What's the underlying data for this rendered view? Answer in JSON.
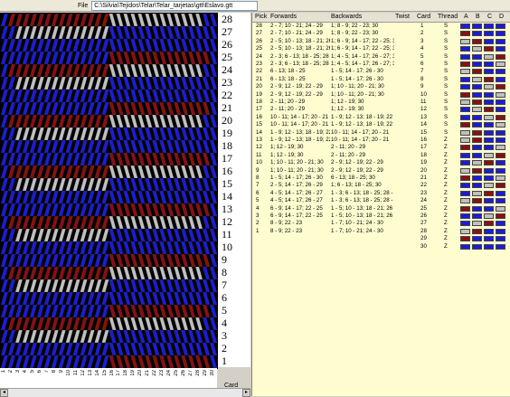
{
  "toolbar": {
    "file_label": "File",
    "path": "C:\\Silvia\\Tejidos\\Telar\\Telar_tarjetas\\gtt\\Eslavo.gtt"
  },
  "colors": {
    "blue": "#1c1cd8",
    "red": "#8a1010",
    "grey": "#c0c0c0",
    "white": "#ffffff"
  },
  "pattern_rows": [
    "28",
    "27",
    "26",
    "25",
    "24",
    "23",
    "22",
    "21",
    "20",
    "19",
    "18",
    "17",
    "16",
    "15",
    "14",
    "13",
    "12",
    "11",
    "10",
    "9",
    "8",
    "7",
    "6",
    "5",
    "4",
    "3",
    "2",
    "1"
  ],
  "card_label": "Card",
  "card_numbers": [
    "1",
    "2",
    "3",
    "4",
    "5",
    "6",
    "7",
    "8",
    "9",
    "10",
    "11",
    "12",
    "13",
    "14",
    "15",
    "16",
    "17",
    "18",
    "19",
    "20",
    "21",
    "22",
    "23",
    "24",
    "25",
    "26",
    "27",
    "28",
    "29",
    "30"
  ],
  "picks_table": {
    "headers": {
      "pick": "Pick",
      "forwards": "Forwards",
      "backwards": "Backwards",
      "twist": "Twist",
      "card": "Card",
      "thread": "Thread",
      "a": "A",
      "b": "B",
      "c": "C",
      "d": "D"
    },
    "picks": [
      {
        "pick": "28",
        "forwards": "2 - 7; 10 - 21; 24 - 29",
        "backwards": "1; 8 - 9; 22 - 23; 30"
      },
      {
        "pick": "27",
        "forwards": "2 - 7; 10 - 21; 24 - 29",
        "backwards": "1; 8 - 9; 22 - 23; 30"
      },
      {
        "pick": "26",
        "forwards": "2 - 5; 10 - 13; 18 - 21; 26 - 29",
        "backwards": "1; 6 - 9; 14 - 17; 22 - 25; 30"
      },
      {
        "pick": "25",
        "forwards": "2 - 5; 10 - 13; 18 - 21; 26 - 29",
        "backwards": "1; 6 - 9; 14 - 17; 22 - 25; 30"
      },
      {
        "pick": "24",
        "forwards": "2 - 3; 6 - 13; 18 - 25; 28 - 29",
        "backwards": "1; 4 - 5; 14 - 17; 26 - 27; 30"
      },
      {
        "pick": "23",
        "forwards": "2 - 3; 6 - 13; 18 - 25; 28 - 29",
        "backwards": "1; 4 - 5; 14 - 17; 26 - 27; 30"
      },
      {
        "pick": "22",
        "forwards": "6 - 13; 18 - 25",
        "backwards": "1 - 5; 14 - 17; 26 - 30"
      },
      {
        "pick": "21",
        "forwards": "6 - 13; 18 - 25",
        "backwards": "1 - 5; 14 - 17; 26 - 30"
      },
      {
        "pick": "20",
        "forwards": "2 - 9; 12 - 19; 22 - 29",
        "backwards": "1; 10 - 11; 20 - 21; 30"
      },
      {
        "pick": "19",
        "forwards": "2 - 9; 12 - 19; 22 - 29",
        "backwards": "1; 10 - 11; 20 - 21; 30"
      },
      {
        "pick": "18",
        "forwards": "2 - 11; 20 - 29",
        "backwards": "1; 12 - 19; 30"
      },
      {
        "pick": "17",
        "forwards": "2 - 11; 20 - 29",
        "backwards": "1; 12 - 19; 30"
      },
      {
        "pick": "16",
        "forwards": "10 - 11; 14 - 17; 20 - 21",
        "backwards": "1 - 9; 12 - 13; 18 - 19; 22 - 30"
      },
      {
        "pick": "15",
        "forwards": "10 - 11; 14 - 17; 20 - 21",
        "backwards": "1 - 9; 12 - 13; 18 - 19; 22 - 30"
      },
      {
        "pick": "14",
        "forwards": "1 - 9; 12 - 13; 18 - 19; 22 - 30",
        "backwards": "10 - 11; 14 - 17; 20 - 21"
      },
      {
        "pick": "13",
        "forwards": "1 - 9; 12 - 13; 18 - 19; 22 - 30",
        "backwards": "10 - 11; 14 - 17; 20 - 21"
      },
      {
        "pick": "12",
        "forwards": "1; 12 - 19; 30",
        "backwards": "2 - 11; 20 - 29"
      },
      {
        "pick": "11",
        "forwards": "1; 12 - 19; 30",
        "backwards": "2 - 11; 20 - 29"
      },
      {
        "pick": "10",
        "forwards": "1; 10 - 11; 20 - 21; 30",
        "backwards": "2 - 9; 12 - 19; 22 - 29"
      },
      {
        "pick": "9",
        "forwards": "1; 10 - 11; 20 - 21; 30",
        "backwards": "2 - 9; 12 - 19; 22 - 29"
      },
      {
        "pick": "8",
        "forwards": "1 - 5; 14 - 17; 26 - 30",
        "backwards": "6 - 13; 18 - 25; 30"
      },
      {
        "pick": "7",
        "forwards": "2 - 5; 14 - 17; 26 - 29",
        "backwards": "1; 6 - 13; 18 - 25; 30"
      },
      {
        "pick": "6",
        "forwards": "4 - 5; 14 - 17; 26 - 27",
        "backwards": "1 - 3; 6 - 13; 18 - 25; 28 - 30"
      },
      {
        "pick": "5",
        "forwards": "4 - 5; 14 - 17; 26 - 27",
        "backwards": "1 - 3; 6 - 13; 18 - 25; 28 - 30"
      },
      {
        "pick": "4",
        "forwards": "6 - 9; 14 - 17; 22 - 25",
        "backwards": "1 - 5; 10 - 13; 18 - 21; 26 - 30"
      },
      {
        "pick": "3",
        "forwards": "6 - 9; 14 - 17; 22 - 25",
        "backwards": "1 - 5; 10 - 13; 18 - 21; 26 - 30"
      },
      {
        "pick": "2",
        "forwards": "8 - 9; 22 - 23",
        "backwards": "1 - 7; 10 - 21; 24 - 30"
      },
      {
        "pick": "1",
        "forwards": "8 - 9; 22 - 23",
        "backwards": "1 - 7; 10 - 21; 24 - 30"
      }
    ],
    "cards": [
      {
        "card": "1",
        "thread": "S",
        "a": "blue",
        "b": "blue",
        "c": "blue",
        "d": "blue"
      },
      {
        "card": "2",
        "thread": "S",
        "a": "red",
        "b": "blue",
        "c": "blue",
        "d": "blue"
      },
      {
        "card": "3",
        "thread": "S",
        "a": "grey",
        "b": "red",
        "c": "blue",
        "d": "blue"
      },
      {
        "card": "4",
        "thread": "S",
        "a": "blue",
        "b": "grey",
        "c": "red",
        "d": "blue"
      },
      {
        "card": "5",
        "thread": "S",
        "a": "blue",
        "b": "blue",
        "c": "grey",
        "d": "red"
      },
      {
        "card": "6",
        "thread": "S",
        "a": "red",
        "b": "blue",
        "c": "blue",
        "d": "grey"
      },
      {
        "card": "7",
        "thread": "S",
        "a": "grey",
        "b": "red",
        "c": "blue",
        "d": "blue"
      },
      {
        "card": "8",
        "thread": "S",
        "a": "blue",
        "b": "grey",
        "c": "red",
        "d": "blue"
      },
      {
        "card": "9",
        "thread": "S",
        "a": "blue",
        "b": "blue",
        "c": "grey",
        "d": "red"
      },
      {
        "card": "10",
        "thread": "S",
        "a": "red",
        "b": "blue",
        "c": "blue",
        "d": "grey"
      },
      {
        "card": "11",
        "thread": "S",
        "a": "grey",
        "b": "red",
        "c": "blue",
        "d": "blue"
      },
      {
        "card": "12",
        "thread": "S",
        "a": "blue",
        "b": "grey",
        "c": "red",
        "d": "blue"
      },
      {
        "card": "13",
        "thread": "S",
        "a": "blue",
        "b": "blue",
        "c": "grey",
        "d": "red"
      },
      {
        "card": "14",
        "thread": "S",
        "a": "red",
        "b": "blue",
        "c": "blue",
        "d": "grey"
      },
      {
        "card": "15",
        "thread": "S",
        "a": "grey",
        "b": "red",
        "c": "blue",
        "d": "blue"
      },
      {
        "card": "16",
        "thread": "Z",
        "a": "grey",
        "b": "red",
        "c": "blue",
        "d": "blue"
      },
      {
        "card": "17",
        "thread": "Z",
        "a": "red",
        "b": "blue",
        "c": "blue",
        "d": "grey"
      },
      {
        "card": "18",
        "thread": "Z",
        "a": "blue",
        "b": "blue",
        "c": "grey",
        "d": "red"
      },
      {
        "card": "19",
        "thread": "Z",
        "a": "blue",
        "b": "grey",
        "c": "red",
        "d": "blue"
      },
      {
        "card": "20",
        "thread": "Z",
        "a": "grey",
        "b": "red",
        "c": "blue",
        "d": "blue"
      },
      {
        "card": "21",
        "thread": "Z",
        "a": "red",
        "b": "blue",
        "c": "blue",
        "d": "grey"
      },
      {
        "card": "22",
        "thread": "Z",
        "a": "blue",
        "b": "blue",
        "c": "grey",
        "d": "red"
      },
      {
        "card": "23",
        "thread": "Z",
        "a": "blue",
        "b": "grey",
        "c": "red",
        "d": "blue"
      },
      {
        "card": "24",
        "thread": "Z",
        "a": "grey",
        "b": "red",
        "c": "blue",
        "d": "blue"
      },
      {
        "card": "25",
        "thread": "Z",
        "a": "red",
        "b": "blue",
        "c": "blue",
        "d": "grey"
      },
      {
        "card": "26",
        "thread": "Z",
        "a": "blue",
        "b": "blue",
        "c": "grey",
        "d": "red"
      },
      {
        "card": "27",
        "thread": "Z",
        "a": "blue",
        "b": "grey",
        "c": "red",
        "d": "blue"
      },
      {
        "card": "28",
        "thread": "Z",
        "a": "grey",
        "b": "red",
        "c": "blue",
        "d": "blue"
      },
      {
        "card": "29",
        "thread": "Z",
        "a": "red",
        "b": "blue",
        "c": "blue",
        "d": "blue"
      },
      {
        "card": "30",
        "thread": "Z",
        "a": "blue",
        "b": "blue",
        "c": "blue",
        "d": "blue"
      }
    ]
  }
}
